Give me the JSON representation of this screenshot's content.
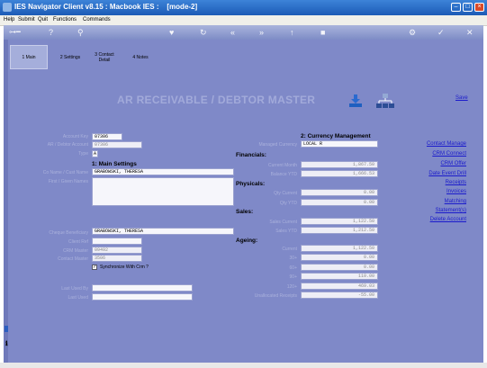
{
  "window": {
    "title": "IES Navigator Client v8.15 : Macbook IES :",
    "mode": "[mode-2]"
  },
  "menu": [
    "Help",
    "Submit",
    "Quit",
    "Functions",
    "Commands"
  ],
  "tabs": [
    {
      "label": "1 Main",
      "active": true
    },
    {
      "label": "2 Settings",
      "active": false
    },
    {
      "label": "3 Contact Detail",
      "active": false
    },
    {
      "label": "4 Notes",
      "active": false
    }
  ],
  "page_title": "AR RECEIVABLE / DEBTOR MASTER",
  "save_label": "Save",
  "left": {
    "account_key": {
      "label": "Account Key",
      "value": "07306"
    },
    "ar_debtor_account": {
      "label": "AR / Debtor Account",
      "value": "07306"
    },
    "type": {
      "label": "Type",
      "value": "A"
    },
    "main_settings_title": "1: Main Settings",
    "co_name": {
      "label": "Co Name / Cust Name",
      "value": "GRABOWSKI, THERESA"
    },
    "first_given_names": {
      "label": "First / Given Names",
      "value": ""
    },
    "cheque_beneficiary": {
      "label": "Cheque Beneficiary",
      "value": "GRABOWSKI, THERESA"
    },
    "client_ref": {
      "label": "Client Ref",
      "value": ""
    },
    "crm_master": {
      "label": "CRM Master",
      "value": "09492"
    },
    "contact_master": {
      "label": "Contact Master",
      "value": "3506"
    },
    "sync_crm": {
      "label": "Synchronize With Crm ?",
      "checked": true
    },
    "last_used_by": {
      "label": "Last Used By",
      "value": ""
    },
    "last_used": {
      "label": "Last Used",
      "value": ""
    }
  },
  "right": {
    "currency_title": "2: Currency Management",
    "managed_currency": {
      "label": "Managed Currency",
      "value": "LOCAL R"
    },
    "financials_title": "Financials:",
    "current_month": {
      "label": "Current Month",
      "value": "1,867.50"
    },
    "balance_ytd": {
      "label": "Balance YTD",
      "value": "1,666.53"
    },
    "physicals_title": "Physicals:",
    "qty_current": {
      "label": "Qty Current",
      "value": "0.00"
    },
    "qty_ytd": {
      "label": "Qty YTD",
      "value": "0.00"
    },
    "sales_title": "Sales:",
    "sales_current": {
      "label": "Sales Current",
      "value": "1,122.50"
    },
    "sales_ytd": {
      "label": "Sales YTD",
      "value": "1,212.50"
    },
    "ageing_title": "Ageing:",
    "ageing": [
      {
        "label": "Current",
        "value": "1,122.50"
      },
      {
        "label": "30+",
        "value": "0.00"
      },
      {
        "label": "60+",
        "value": "0.00"
      },
      {
        "label": "90+",
        "value": "110.00"
      },
      {
        "label": "120+",
        "value": "469.03"
      },
      {
        "label": "Unallocated Receipts",
        "value": "-55.00"
      }
    ]
  },
  "links": [
    "Contact Manage",
    "CRM Connect",
    "CRM Offer",
    "Date Event Drill",
    "Receipts",
    "Invoices",
    "Matching",
    "Statement(s)",
    "Delete Account"
  ]
}
